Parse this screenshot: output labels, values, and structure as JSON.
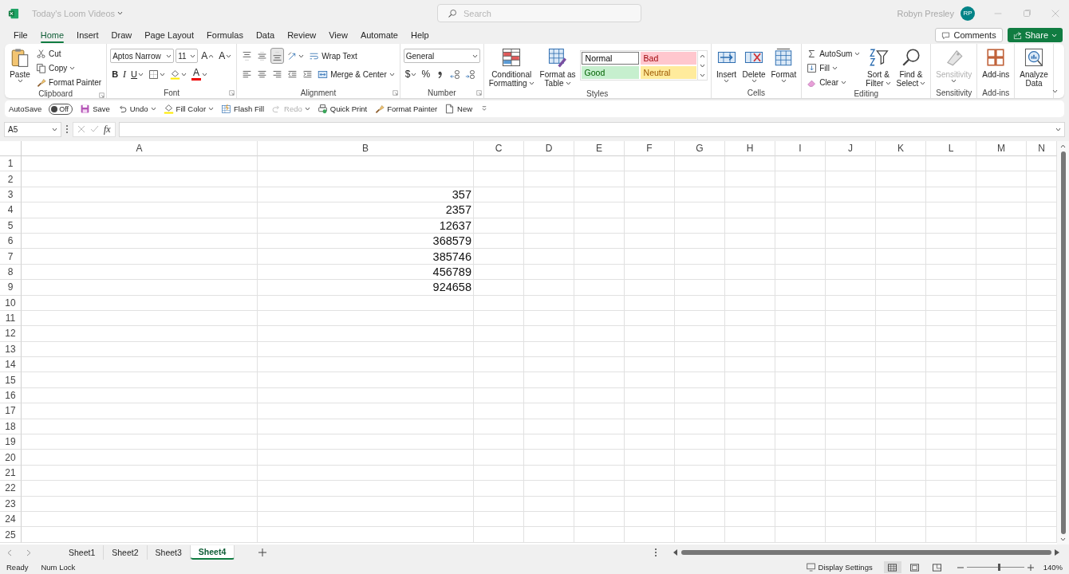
{
  "window": {
    "title": "Today's Loom Videos",
    "search_placeholder": "Search",
    "user": "Robyn Presley",
    "avatar": "RP"
  },
  "menu_tabs": [
    {
      "label": "File",
      "selected": false
    },
    {
      "label": "Home",
      "selected": true
    },
    {
      "label": "Insert",
      "selected": false
    },
    {
      "label": "Draw",
      "selected": false
    },
    {
      "label": "Page Layout",
      "selected": false
    },
    {
      "label": "Formulas",
      "selected": false
    },
    {
      "label": "Data",
      "selected": false
    },
    {
      "label": "Review",
      "selected": false
    },
    {
      "label": "View",
      "selected": false
    },
    {
      "label": "Automate",
      "selected": false
    },
    {
      "label": "Help",
      "selected": false
    }
  ],
  "header_buttons": [
    {
      "label": "Comments",
      "kind": "outline"
    },
    {
      "label": "Share",
      "kind": "primary"
    }
  ],
  "ribbon": [
    {
      "label": "Clipboard",
      "launcher": true,
      "columns": [
        [
          {
            "kind": "large",
            "lines": [
              "Paste"
            ],
            "caret": true,
            "disabled": false
          }
        ],
        [
          {
            "kind": "small",
            "label": "Cut"
          },
          {
            "kind": "small",
            "label": "Copy",
            "caret": true
          },
          {
            "kind": "small",
            "label": "Format Painter"
          }
        ]
      ]
    },
    {
      "label": "Font",
      "launcher": true,
      "rows": [
        {
          "items": [
            {
              "kind": "combo",
              "value": "Aptos Narrow"
            },
            {
              "kind": "combo",
              "value": "11"
            },
            {
              "kind": "glyph",
              "text": "A"
            },
            {
              "kind": "glyph",
              "text": "A"
            }
          ]
        },
        {
          "items": [
            {
              "kind": "glyph",
              "text": "B"
            },
            {
              "kind": "glyph",
              "text": "I"
            },
            {
              "kind": "glyph",
              "text": "U",
              "caret": true
            },
            {
              "kind": "icon",
              "caret": true
            },
            {
              "kind": "icon",
              "caret": true
            },
            {
              "kind": "glyph",
              "text": "A",
              "caret": true
            }
          ]
        }
      ]
    },
    {
      "label": "Alignment",
      "launcher": true,
      "rows": [
        {
          "items": [
            {
              "kind": "icon",
              "selected": false
            },
            {
              "kind": "icon",
              "selected": false
            },
            {
              "kind": "icon",
              "selected": true
            },
            {
              "kind": "icon",
              "caret": true
            },
            {
              "kind": "small",
              "label": "Wrap Text"
            }
          ]
        },
        {
          "items": [
            {
              "kind": "icon",
              "selected": false
            },
            {
              "kind": "icon",
              "selected": false
            },
            {
              "kind": "icon",
              "selected": false
            },
            {
              "kind": "icon"
            },
            {
              "kind": "icon"
            },
            {
              "kind": "small",
              "label": "Merge & Center",
              "caret": true
            }
          ]
        }
      ]
    },
    {
      "label": "Number",
      "launcher": true,
      "rows": [
        {
          "items": [
            {
              "kind": "combo",
              "value": "General"
            }
          ]
        },
        {
          "items": [
            {
              "kind": "glyph",
              "text": "$",
              "caret": true
            },
            {
              "kind": "glyph",
              "text": "%"
            },
            {
              "kind": "icon"
            },
            {
              "kind": "icon"
            },
            {
              "kind": "icon"
            }
          ]
        }
      ]
    },
    {
      "label": "Styles",
      "columns": [
        [
          {
            "kind": "large",
            "lines": [
              "Conditional",
              "Formatting"
            ],
            "caret": true,
            "disabled": false
          }
        ],
        [
          {
            "kind": "large",
            "lines": [
              "Format as",
              "Table"
            ],
            "caret": true,
            "disabled": false
          }
        ],
        [
          {
            "kind": "gallery",
            "styles": [
              {
                "label": "Normal",
                "color": "#ffffff"
              },
              {
                "label": "Bad",
                "color": "#ffc7ce"
              },
              {
                "label": "Good",
                "color": "#c6efce"
              },
              {
                "label": "Neutral",
                "color": "#ffeb9c"
              }
            ]
          }
        ]
      ]
    },
    {
      "label": "Cells",
      "columns": [
        [
          {
            "kind": "large",
            "lines": [
              "Insert"
            ],
            "caret": true,
            "disabled": false
          }
        ],
        [
          {
            "kind": "large",
            "lines": [
              "Delete"
            ],
            "caret": true,
            "disabled": false
          }
        ],
        [
          {
            "kind": "large",
            "lines": [
              "Format"
            ],
            "caret": true,
            "disabled": false
          }
        ]
      ]
    },
    {
      "label": "Editing",
      "columns": [
        [
          {
            "kind": "small",
            "label": "AutoSum",
            "caret": true
          },
          {
            "kind": "small",
            "label": "Fill",
            "caret": true
          },
          {
            "kind": "small",
            "label": "Clear",
            "caret": true
          }
        ],
        [
          {
            "kind": "large",
            "lines": [
              "Sort &",
              "Filter"
            ],
            "caret": true,
            "disabled": false
          }
        ],
        [
          {
            "kind": "large",
            "lines": [
              "Find &",
              "Select"
            ],
            "caret": true,
            "disabled": false
          }
        ]
      ]
    },
    {
      "label": "Sensitivity",
      "columns": [
        [
          {
            "kind": "large",
            "lines": [
              "Sensitivity"
            ],
            "caret": true,
            "disabled": true
          }
        ]
      ]
    },
    {
      "label": "Add-ins",
      "columns": [
        [
          {
            "kind": "large",
            "lines": [
              "Add-ins"
            ],
            "disabled": false
          }
        ]
      ]
    },
    {
      "columns": [
        [
          {
            "kind": "large",
            "lines": [
              "Analyze",
              "Data"
            ],
            "disabled": false
          }
        ]
      ]
    }
  ],
  "quick_access": {
    "autosave": {
      "label": "AutoSave",
      "on": false,
      "state_text": "Off"
    },
    "items": [
      {
        "label": "Save",
        "disabled": false
      },
      {
        "label": "Undo",
        "caret": true,
        "disabled": false
      },
      {
        "label": "Fill Color",
        "caret": true,
        "disabled": false
      },
      {
        "label": "Flash Fill",
        "disabled": false
      },
      {
        "label": "Redo",
        "caret": true,
        "disabled": true
      },
      {
        "label": "Quick Print",
        "disabled": false
      },
      {
        "label": "Format Painter",
        "disabled": false
      },
      {
        "label": "New",
        "disabled": false
      }
    ]
  },
  "formula_bar": {
    "name_box": "A5",
    "fx": "fx"
  },
  "grid": {
    "columns": [
      "A",
      "B",
      "C",
      "D",
      "E",
      "F",
      "G",
      "H",
      "I",
      "J",
      "K",
      "L",
      "M",
      "N"
    ],
    "rows": [
      {
        "label": "1"
      },
      {
        "label": "2"
      },
      {
        "label": "3",
        "B": "357"
      },
      {
        "label": "4",
        "B": "2357"
      },
      {
        "label": "5",
        "B": "12637"
      },
      {
        "label": "6",
        "B": "368579"
      },
      {
        "label": "7",
        "B": "385746"
      },
      {
        "label": "8",
        "B": "456789"
      },
      {
        "label": "9",
        "B": "924658"
      },
      {
        "label": "10"
      },
      {
        "label": "11"
      },
      {
        "label": "12"
      },
      {
        "label": "13"
      },
      {
        "label": "14"
      },
      {
        "label": "15"
      },
      {
        "label": "16"
      },
      {
        "label": "17"
      },
      {
        "label": "18"
      },
      {
        "label": "19"
      },
      {
        "label": "20"
      },
      {
        "label": "21"
      },
      {
        "label": "22"
      },
      {
        "label": "23"
      },
      {
        "label": "24"
      },
      {
        "label": "25"
      }
    ]
  },
  "sheets": [
    {
      "label": "Sheet1",
      "selected": false
    },
    {
      "label": "Sheet2",
      "selected": false
    },
    {
      "label": "Sheet3",
      "selected": false
    },
    {
      "label": "Sheet4",
      "selected": true
    }
  ],
  "status_bar": {
    "left": [
      "Ready",
      "Num Lock"
    ],
    "display_settings": "Display Settings",
    "views": [
      {
        "selected": true
      },
      {
        "selected": false
      },
      {
        "selected": false
      }
    ],
    "zoom_slider": {
      "level": 0.55
    },
    "zoom": "140%"
  }
}
